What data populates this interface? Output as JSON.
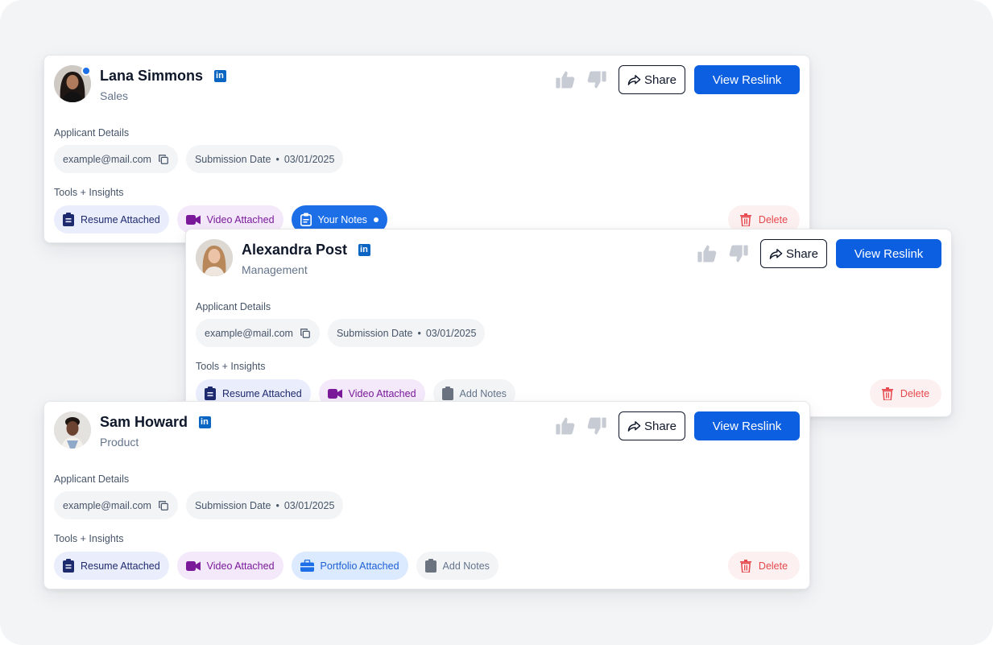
{
  "section_labels": {
    "details": "Applicant Details",
    "tools": "Tools + Insights"
  },
  "buttons": {
    "share": "Share",
    "view_reslink": "View Reslink",
    "delete": "Delete"
  },
  "colors": {
    "primary": "#0b5fe0",
    "active_chip": "#1d6fe8",
    "delete": "#e5484d",
    "linkedin": "#0a66c2"
  },
  "applicants": [
    {
      "name": "Lana Simmons",
      "role": "Sales",
      "online": true,
      "email": "example@mail.com",
      "submission_label": "Submission Date",
      "submission_date": "03/01/2025",
      "tools": {
        "resume": "Resume Attached",
        "video": "Video Attached",
        "notes": "Your Notes"
      }
    },
    {
      "name": "Alexandra Post",
      "role": "Management",
      "online": false,
      "email": "example@mail.com",
      "submission_label": "Submission Date",
      "submission_date": "03/01/2025",
      "tools": {
        "resume": "Resume Attached",
        "video": "Video Attached",
        "notes": "Add Notes"
      }
    },
    {
      "name": "Sam Howard",
      "role": "Product",
      "online": false,
      "email": "example@mail.com",
      "submission_label": "Submission Date",
      "submission_date": "03/01/2025",
      "tools": {
        "resume": "Resume Attached",
        "video": "Video Attached",
        "portfolio": "Portfolio Attached",
        "notes": "Add Notes"
      }
    }
  ]
}
